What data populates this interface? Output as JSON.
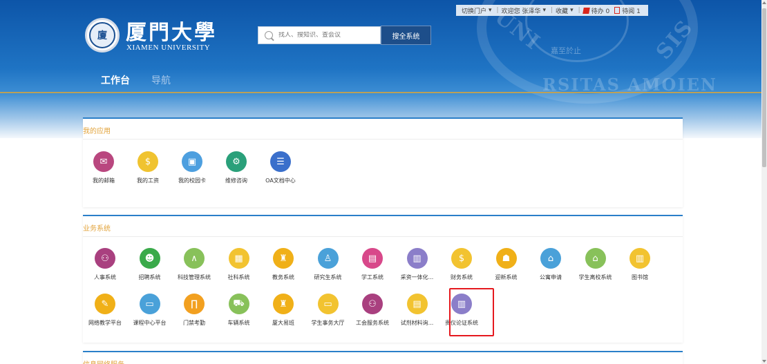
{
  "header": {
    "logo_cn": "厦門大學",
    "logo_en": "XIAMEN UNIVERSITY",
    "seal_text": "UNIVERSITAS AMOIENSIS",
    "seal_motto": "嘉至於止"
  },
  "search": {
    "placeholder": "找人、搜知识、查会议",
    "button_label": "搜全系统"
  },
  "topbar": {
    "switch_portal": "切换门户",
    "welcome": "欢迎您 张泽华",
    "favorites": "收藏",
    "todo": "待办 0",
    "toread": "待阅 1"
  },
  "nav": {
    "workbench": "工作台",
    "navigation": "导航"
  },
  "my_apps": {
    "title": "我的应用",
    "items": [
      {
        "label": "我的邮箱",
        "color": "#b9477f",
        "icon": "mail-icon",
        "glyph": "✉"
      },
      {
        "label": "我的工资",
        "color": "#f0c330",
        "icon": "salary-icon",
        "glyph": "$"
      },
      {
        "label": "我的校园卡",
        "color": "#4d9fdf",
        "icon": "card-icon",
        "glyph": "▣"
      },
      {
        "label": "维修咨询",
        "color": "#2aa07a",
        "icon": "repair-icon",
        "glyph": "⚙"
      },
      {
        "label": "OA文档中心",
        "color": "#3a6fcb",
        "icon": "doc-center-icon",
        "glyph": "☰"
      }
    ]
  },
  "business": {
    "title": "业务系统",
    "row1": [
      {
        "label": "人事系统",
        "color": "#a9407f",
        "icon": "personnel-icon",
        "glyph": "⚇"
      },
      {
        "label": "招聘系统",
        "color": "#3aaa4a",
        "icon": "recruit-icon",
        "glyph": "☻"
      },
      {
        "label": "科技管理系统",
        "color": "#88c15a",
        "icon": "compass-icon",
        "glyph": "∧"
      },
      {
        "label": "社科系统",
        "color": "#f2c330",
        "icon": "calculator-icon",
        "glyph": "▦"
      },
      {
        "label": "教务系统",
        "color": "#f0b018",
        "icon": "teacher-icon",
        "glyph": "♜"
      },
      {
        "label": "研究生系统",
        "color": "#4aa1d9",
        "icon": "graduate-icon",
        "glyph": "♙"
      },
      {
        "label": "学工系统",
        "color": "#d8488a",
        "icon": "book-icon",
        "glyph": "▤"
      },
      {
        "label": "采资一体化...",
        "color": "#8b7ec9",
        "icon": "calendar-icon",
        "glyph": "▥"
      },
      {
        "label": "财务系统",
        "color": "#f2c330",
        "icon": "finance-icon",
        "glyph": "$"
      },
      {
        "label": "迎新系统",
        "color": "#f0b018",
        "icon": "welcome-icon",
        "glyph": "☗"
      },
      {
        "label": "公寓申请",
        "color": "#4aa1d9",
        "icon": "apartment-icon",
        "glyph": "⌂"
      },
      {
        "label": "学生离校系统",
        "color": "#88c15a",
        "icon": "home-icon",
        "glyph": "⌂"
      },
      {
        "label": "图书馆",
        "color": "#f2c330",
        "icon": "library-icon",
        "glyph": "▥"
      }
    ],
    "row2": [
      {
        "label": "网络教学平台",
        "color": "#f0b018",
        "icon": "pen-icon",
        "glyph": "✎"
      },
      {
        "label": "课程中心平台",
        "color": "#4aa1d9",
        "icon": "screen-icon",
        "glyph": "▭"
      },
      {
        "label": "门禁考勤",
        "color": "#f2a020",
        "icon": "gate-icon",
        "glyph": "∏"
      },
      {
        "label": "车辆系统",
        "color": "#88c15a",
        "icon": "car-icon",
        "glyph": "⛟"
      },
      {
        "label": "厦大易班",
        "color": "#f0b018",
        "icon": "yiban-icon",
        "glyph": "♜"
      },
      {
        "label": "学生事务大厅",
        "color": "#f2c330",
        "icon": "hall-icon",
        "glyph": "▭"
      },
      {
        "label": "工会服务系统",
        "color": "#a9407f",
        "icon": "union-icon",
        "glyph": "⚇"
      },
      {
        "label": "试剂材料询...",
        "color": "#f2c330",
        "icon": "reagent-icon",
        "glyph": "▤"
      },
      {
        "label": "贵仪论证系统",
        "color": "#8b7ec9",
        "icon": "instrument-icon",
        "glyph": "▥"
      }
    ]
  },
  "third_section": {
    "title": "信息网络服务"
  }
}
